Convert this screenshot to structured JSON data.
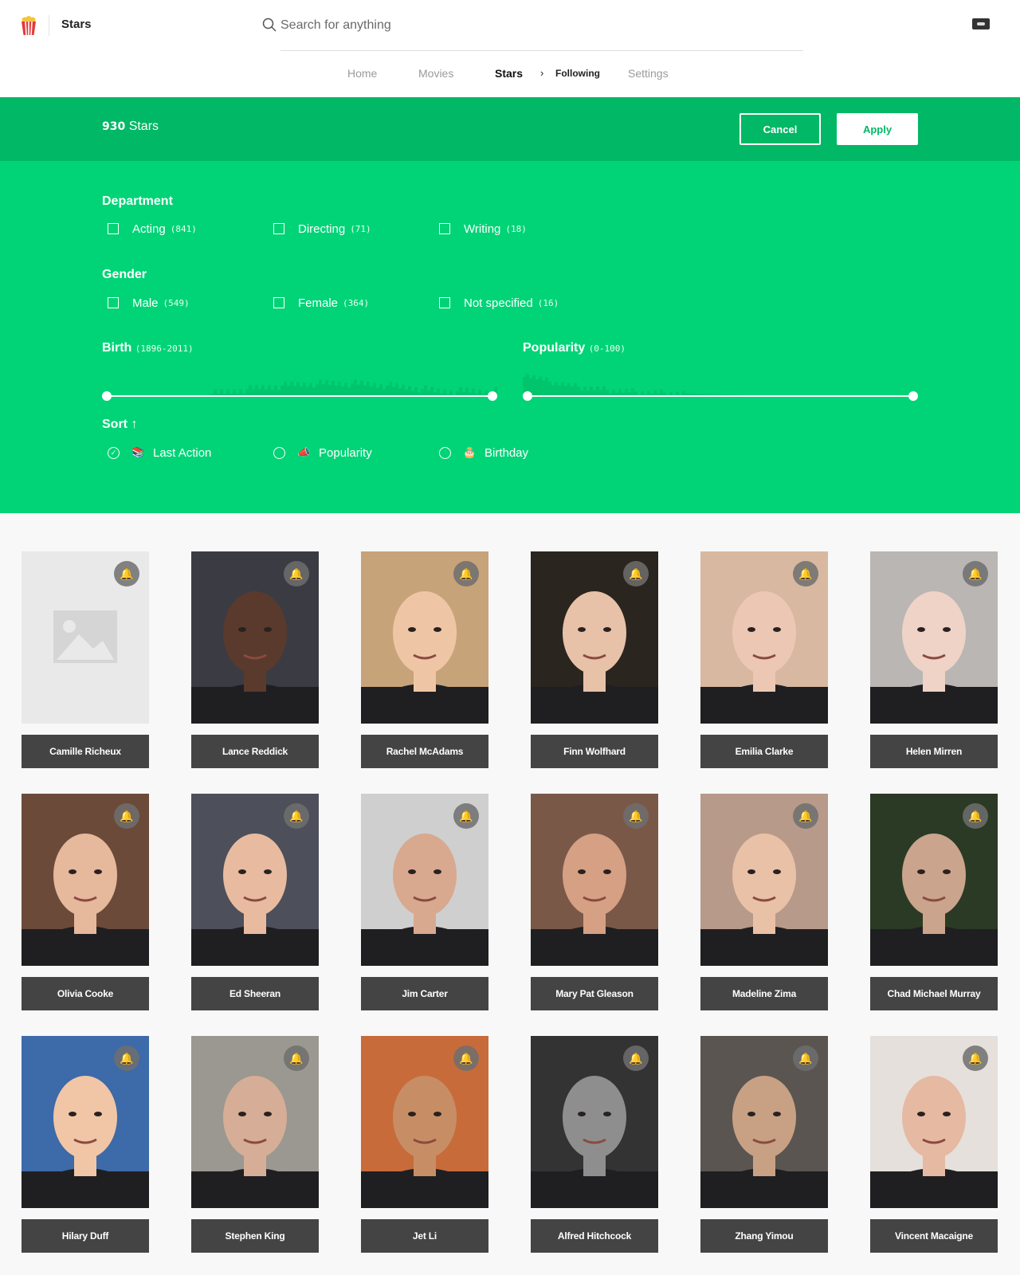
{
  "header": {
    "app_title": "Stars",
    "search_placeholder": "Search for anything",
    "nav": [
      {
        "label": "Home",
        "active": false
      },
      {
        "label": "Movies",
        "active": false
      },
      {
        "label": "Stars",
        "active": true
      },
      {
        "label": "Following",
        "active": false
      },
      {
        "label": "Settings",
        "active": false
      }
    ],
    "breadcrumb_chevron": "›"
  },
  "filter": {
    "count_value": "930",
    "count_label": "Stars",
    "cancel_label": "Cancel",
    "apply_label": "Apply",
    "department": {
      "title": "Department",
      "options": [
        {
          "label": "Acting",
          "count": "(841)"
        },
        {
          "label": "Directing",
          "count": "(71)"
        },
        {
          "label": "Writing",
          "count": "(18)"
        }
      ]
    },
    "gender": {
      "title": "Gender",
      "options": [
        {
          "label": "Male",
          "count": "(549)"
        },
        {
          "label": "Female",
          "count": "(364)"
        },
        {
          "label": "Not specified",
          "count": "(16)"
        }
      ]
    },
    "birth": {
      "title": "Birth",
      "range": "(1896-2011)",
      "min": 1896,
      "max": 2011,
      "selected_min": 1896,
      "selected_max": 2011
    },
    "popularity": {
      "title": "Popularity",
      "range": "(0-100)",
      "min": 0,
      "max": 100,
      "selected_min": 0,
      "selected_max": 100
    },
    "sort": {
      "title": "Sort",
      "direction_glyph": "↑",
      "options": [
        {
          "label": "Last Action",
          "icon": "books-icon",
          "glyph": "📚",
          "selected": true
        },
        {
          "label": "Popularity",
          "icon": "megaphone-icon",
          "glyph": "📣",
          "selected": false
        },
        {
          "label": "Birthday",
          "icon": "birthday-cake-icon",
          "glyph": "🎂",
          "selected": false
        }
      ]
    }
  },
  "colors": {
    "accent": "#00d477",
    "accent_dark": "#00b865",
    "card_label_bg": "#444444"
  },
  "stars": [
    {
      "name": "Camille Richeux",
      "has_photo": false
    },
    {
      "name": "Lance Reddick",
      "has_photo": true
    },
    {
      "name": "Rachel McAdams",
      "has_photo": true
    },
    {
      "name": "Finn Wolfhard",
      "has_photo": true
    },
    {
      "name": "Emilia Clarke",
      "has_photo": true
    },
    {
      "name": "Helen Mirren",
      "has_photo": true
    },
    {
      "name": "Olivia Cooke",
      "has_photo": true
    },
    {
      "name": "Ed Sheeran",
      "has_photo": true
    },
    {
      "name": "Jim Carter",
      "has_photo": true
    },
    {
      "name": "Mary Pat Gleason",
      "has_photo": true
    },
    {
      "name": "Madeline Zima",
      "has_photo": true
    },
    {
      "name": "Chad Michael Murray",
      "has_photo": true
    },
    {
      "name": "Hilary Duff",
      "has_photo": true
    },
    {
      "name": "Stephen King",
      "has_photo": true
    },
    {
      "name": "Jet Li",
      "has_photo": true
    },
    {
      "name": "Alfred Hitchcock",
      "has_photo": true
    },
    {
      "name": "Zhang Yimou",
      "has_photo": true
    },
    {
      "name": "Vincent Macaigne",
      "has_photo": true
    }
  ],
  "bell_glyph": "🔔"
}
